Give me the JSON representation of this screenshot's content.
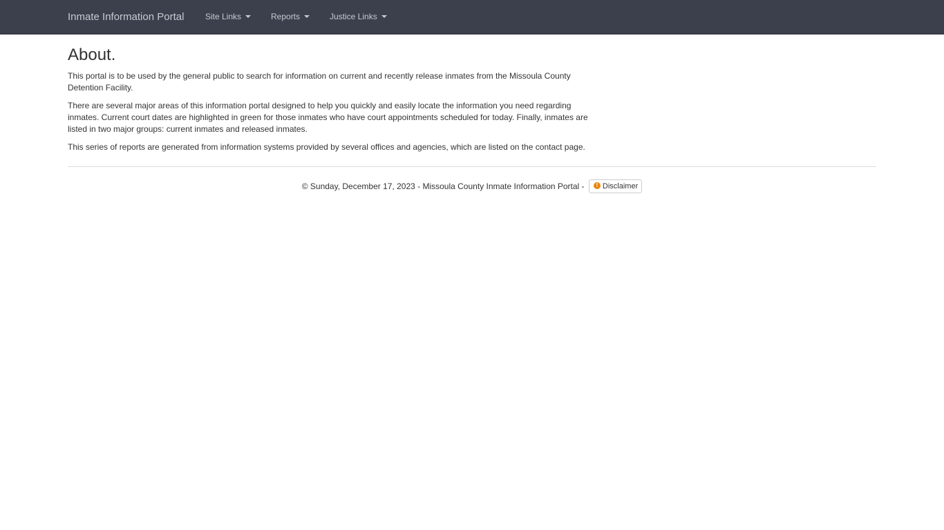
{
  "navbar": {
    "brand": "Inmate Information Portal",
    "items": [
      {
        "label": "Site Links"
      },
      {
        "label": "Reports"
      },
      {
        "label": "Justice Links"
      }
    ],
    "background_color": "#3c404d"
  },
  "main": {
    "title": "About.",
    "paragraphs": [
      "This portal is to be used by the general public to search for information on current and recently release inmates from the Missoula County Detention Facility.",
      "There are several major areas of this information portal designed to help you quickly and easily locate the information you need regarding inmates. Current court dates are highlighted in green for those inmates who have court appointments scheduled for today. Finally, inmates are listed in two major groups: current inmates and released inmates.",
      "This series of reports are generated from information systems provided by several offices and agencies, which are listed on the contact page."
    ]
  },
  "footer": {
    "text": "© Sunday, December 17, 2023 - Missoula County Inmate Information Portal -",
    "disclaimer_label": "Disclaimer",
    "disclaimer_icon": "exclamation-circle-icon",
    "disclaimer_icon_glyph": "!",
    "disclaimer_icon_color": "#e8860e"
  }
}
